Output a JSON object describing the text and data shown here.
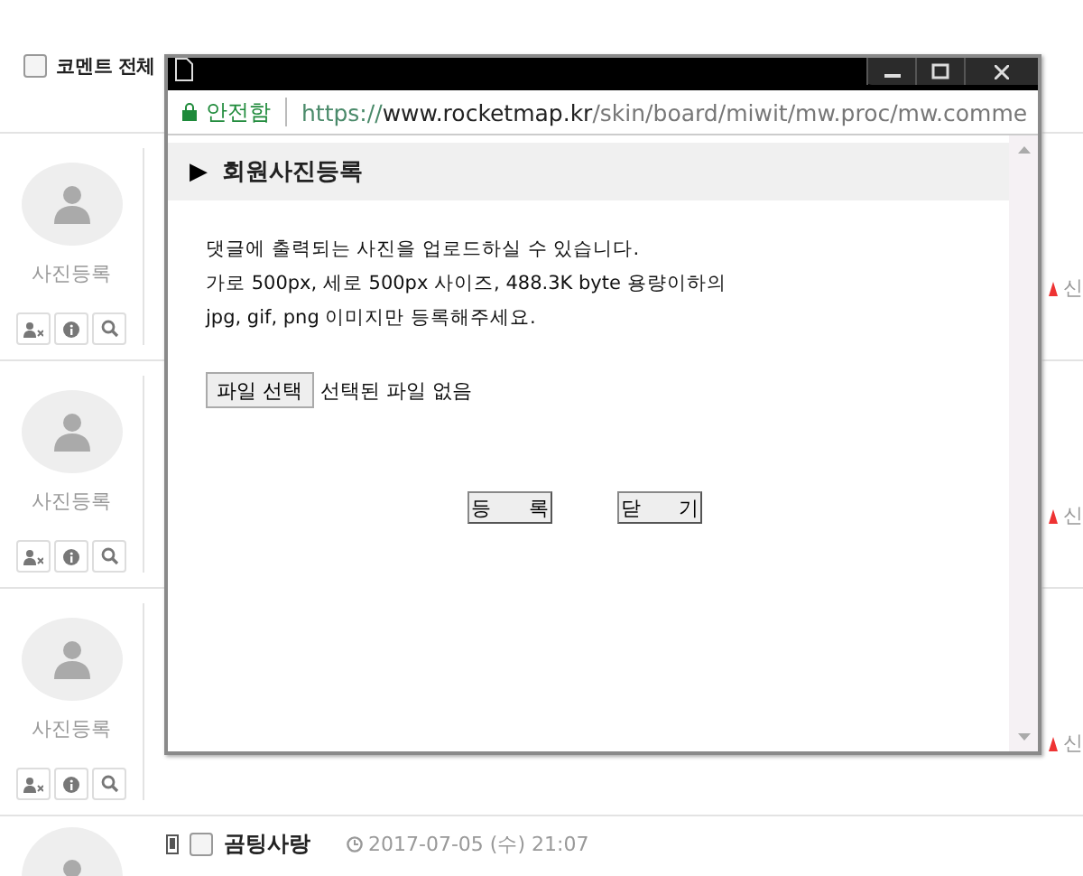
{
  "page": {
    "select_all": {
      "label": "코멘트 전체",
      "checked": false
    },
    "comments": [
      {
        "photo_label": "사진등록",
        "report": "신"
      },
      {
        "photo_label": "사진등록",
        "report": "신"
      },
      {
        "photo_label": "사진등록",
        "report": "신"
      }
    ],
    "last_comment": {
      "author": "곰팅사랑",
      "date": "2017-07-05 (수) 21:07",
      "checked": false
    }
  },
  "popup": {
    "security": "안전함",
    "url_scheme": "https://",
    "url_host": "www.rocketmap.kr",
    "url_path": "/skin/board/miwit/mw.proc/mw.comme",
    "heading_marker": "▶",
    "heading": "회원사진등록",
    "lines": [
      "댓글에 출력되는 사진을 업로드하실 수 있습니다.",
      "가로 500px, 세로 500px 사이즈, 488.3K byte 용량이하의",
      "jpg, gif, png 이미지만 등록해주세요."
    ],
    "file_button": "파일 선택",
    "file_status": "선택된 파일 없음",
    "buttons": [
      "등 록",
      "닫 기"
    ]
  }
}
